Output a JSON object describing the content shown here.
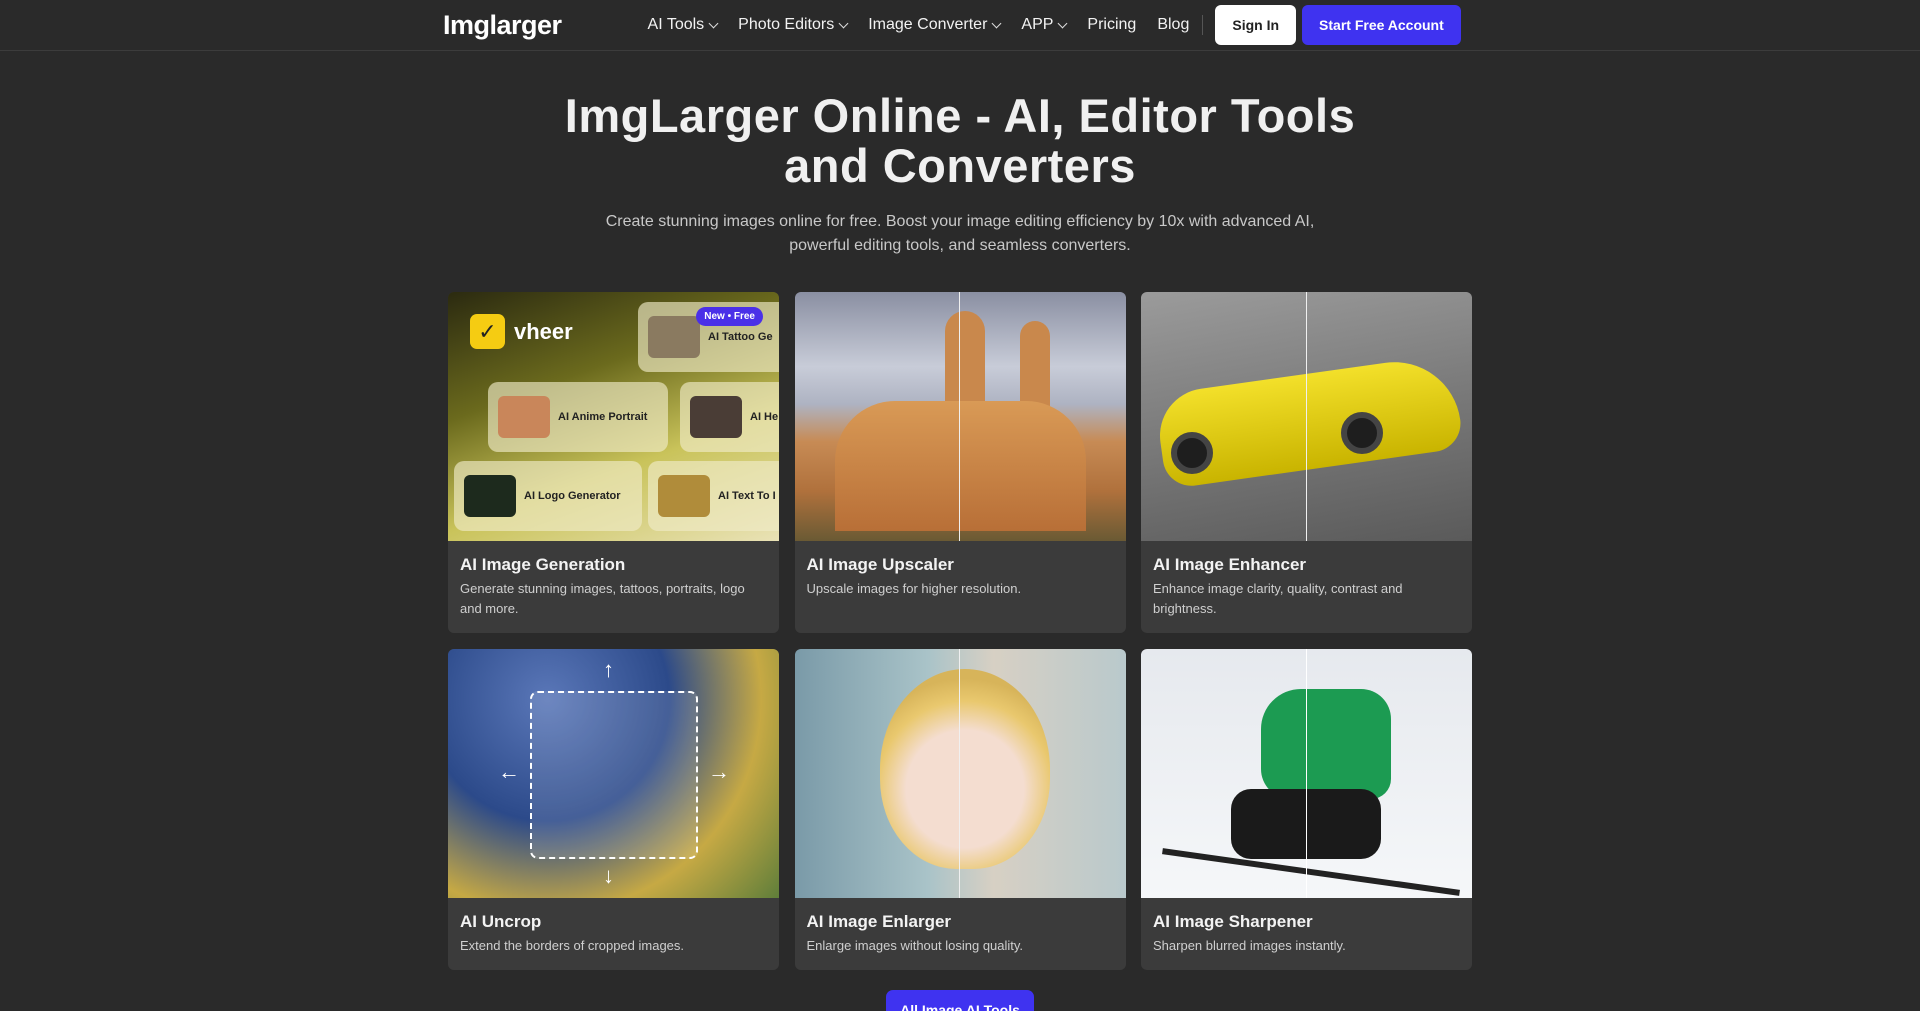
{
  "nav": {
    "logo": "Imglarger",
    "menu": [
      {
        "label": "AI Tools",
        "dropdown": true
      },
      {
        "label": "Photo Editors",
        "dropdown": true
      },
      {
        "label": "Image Converter",
        "dropdown": true
      },
      {
        "label": "APP",
        "dropdown": true
      },
      {
        "label": "Pricing",
        "dropdown": false
      },
      {
        "label": "Blog",
        "dropdown": false
      }
    ],
    "signin_label": "Sign In",
    "start_label": "Start Free Account"
  },
  "hero": {
    "title": "ImgLarger Online - AI, Editor Tools and Converters",
    "subtitle": "Create stunning images online for free. Boost your image editing efficiency by 10x with advanced AI, powerful editing tools, and seamless converters."
  },
  "cards": [
    {
      "title": "AI Image Generation",
      "desc": "Generate stunning images, tattoos, portraits, logo and more.",
      "image": {
        "brand": "vheer",
        "badge": "New • Free",
        "tiles": [
          "AI Tattoo Ge",
          "AI Anime Portrait",
          "AI He",
          "AI Logo Generator",
          "AI Text To I"
        ]
      }
    },
    {
      "title": "AI Image Upscaler",
      "desc": "Upscale images for higher resolution."
    },
    {
      "title": "AI Image Enhancer",
      "desc": "Enhance image clarity, quality, contrast and brightness."
    },
    {
      "title": "AI Uncrop",
      "desc": "Extend the borders of cropped images."
    },
    {
      "title": "AI Image Enlarger",
      "desc": "Enlarge images without losing quality."
    },
    {
      "title": "AI Image Sharpener",
      "desc": "Sharpen blurred images instantly."
    }
  ],
  "all_tools_label": "All Image AI Tools",
  "colors": {
    "accent": "#3f33f0",
    "background": "#2a2a2a",
    "card": "#3b3b3b"
  }
}
